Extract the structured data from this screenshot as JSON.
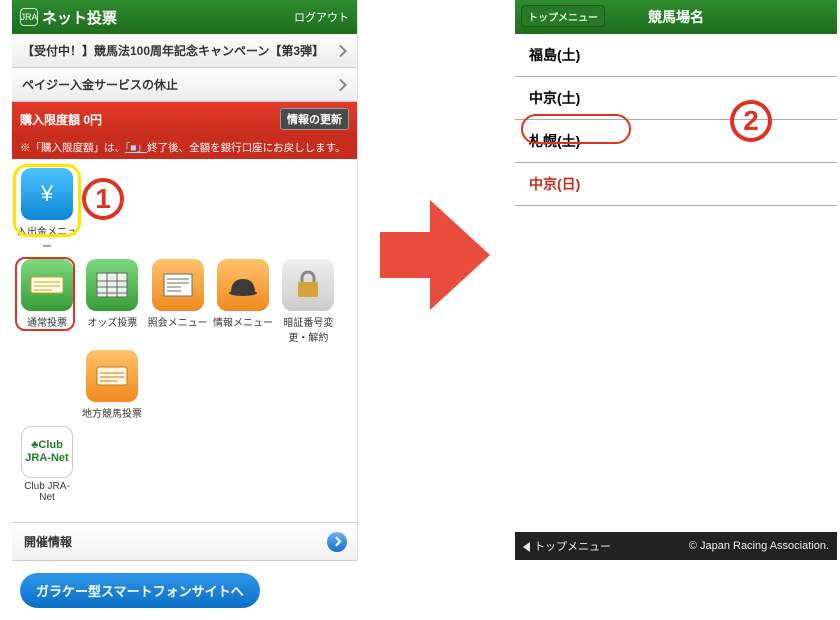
{
  "left": {
    "header": {
      "brand": "JRA",
      "title": "ネット投票",
      "logout": "ログアウト"
    },
    "notices": [
      "【受付中！】競馬法100周年記念キャンペーン【第3弾】",
      "ペイジー入金サービスの休止"
    ],
    "limit": {
      "label": "購入限度額 0円",
      "update_btn": "情報の更新"
    },
    "limit_note_pre": "※「購入限度額」は、",
    "limit_note_link": "「■」",
    "limit_note_post": "終了後、全額を銀行口座にお戻しします。",
    "icons": {
      "deposit": "入出金メニュー",
      "normal_bet": "通常投票",
      "odds_bet": "オッズ投票",
      "inquiry": "照会メニュー",
      "info": "情報メニュー",
      "pin": "暗証番号変更・解約",
      "local": "地方競馬投票",
      "club": "Club JRA-Net"
    },
    "section": "開催情報",
    "bottom_button": "ガラケー型スマートフォンサイトへ"
  },
  "right": {
    "back": "トップメニュー",
    "title": "競馬場名",
    "items": [
      "福島(土)",
      "中京(土)",
      "札幌(土)",
      "中京(日)"
    ],
    "footer_left": "トップメニュー",
    "footer_right": "© Japan Racing Association."
  },
  "annotations": {
    "one": "1",
    "two": "2"
  }
}
